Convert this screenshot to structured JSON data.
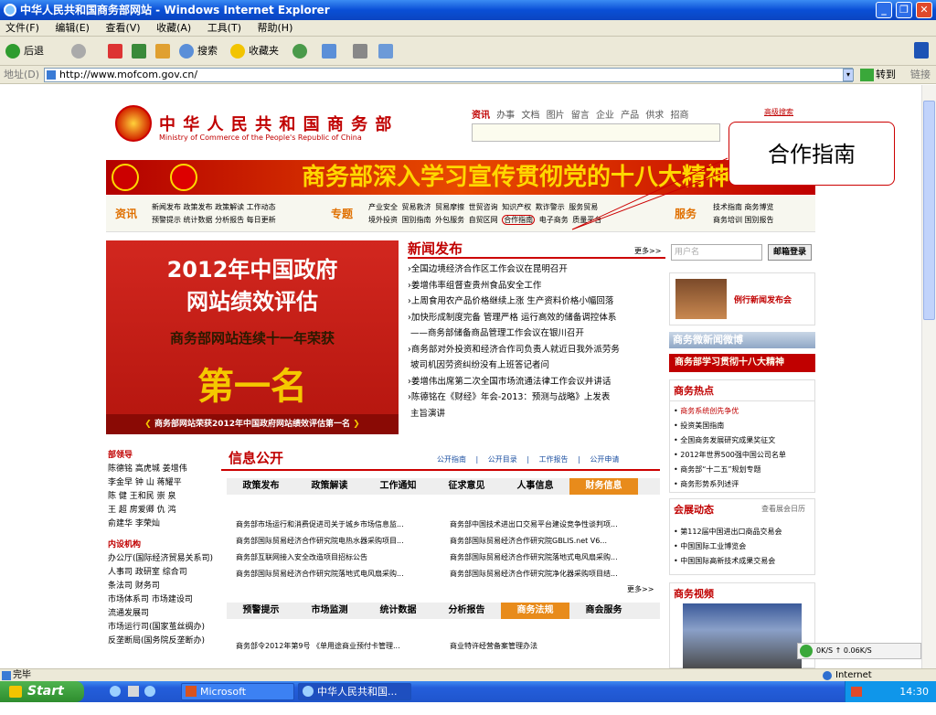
{
  "window": {
    "title": "中华人民共和国商务部网站 - Windows Internet Explorer",
    "min": "_",
    "max": "❐",
    "close": "✕"
  },
  "menu": [
    "文件(F)",
    "编辑(E)",
    "查看(V)",
    "收藏(A)",
    "工具(T)",
    "帮助(H)"
  ],
  "toolbar": {
    "back": "后退",
    "search": "搜索",
    "favorites": "收藏夹"
  },
  "address": {
    "label": "地址(D)",
    "url": "http://www.mofcom.gov.cn/",
    "go": "转到",
    "links": "链接"
  },
  "header": {
    "logo_cn": "中 华 人 民 共 和 国 商 务 部",
    "logo_en": "Ministry of Commerce of the People's Republic of China",
    "search_tabs": [
      "资讯",
      "办事",
      "文档",
      "图片",
      "留言",
      "企业",
      "产品",
      "供求",
      "招商"
    ],
    "advanced_search": "高级搜索"
  },
  "banner": {
    "text": "商务部深入学习宣传贯彻党的十八大精神"
  },
  "nav": {
    "g1_label": "资讯",
    "g1_row1": [
      "新闻发布",
      "政策发布",
      "政策解读",
      "工作动态"
    ],
    "g1_row2": [
      "预警提示",
      "统计数据",
      "分析报告",
      "每日更新"
    ],
    "g2_label": "专题",
    "g2_row1": [
      "产业安全",
      "贸易救济",
      "贸易摩擦",
      "世贸咨询",
      "知识产权",
      "欺诈警示",
      "服务贸易"
    ],
    "g2_row2": [
      "境外投资",
      "国别指南",
      "外包服务",
      "自贸区网",
      "合作指南",
      "电子商务",
      "质量平台"
    ],
    "g3_label": "服务",
    "g3_row1": [
      "技术指南",
      "商务博览"
    ],
    "g3_row2": [
      "商务培训",
      "国别报告"
    ]
  },
  "feature": {
    "line1": "2012年中国政府",
    "line2": "网站绩效评估",
    "line3": "商务部网站连续十一年荣获",
    "line4": "第一名",
    "caption": "商务部网站荣获2012年中国政府网站绩效评估第一名"
  },
  "news": {
    "title": "新闻发布",
    "more": "更多>>",
    "items": [
      "全国边境经济合作区工作会议在昆明召开",
      "姜增伟率组督查贵州食品安全工作",
      "上周食用农产品价格继续上涨 生产资料价格小幅回落",
      "加快形成制度完备 管理严格 运行高效的储备调控体系",
      "——商务部储备商品管理工作会议在银川召开",
      "商务部对外投资和经济合作司负责人就近日我外派劳务",
      "坡司机因劳资纠纷没有上班答记者问",
      "姜增伟出席第二次全国市场流通法律工作会议并讲话",
      "陈德铭在《财经》年会-2013：预测与战略》上发表",
      "主旨演讲"
    ]
  },
  "login": {
    "placeholder": "用户名",
    "button": "邮箱登录"
  },
  "right": {
    "press_conf": "例行新闻发布会",
    "weibo": "商务微新闻微博",
    "study": "商务部学习贯彻十八大精神",
    "hot_title": "商务热点",
    "hot_items": [
      "商务系统创先争优",
      "投资美国指南",
      "全国商务发展研究成果奖征文",
      "2012年世界500强中国公司名单",
      "商务部“十二五”规划专题",
      "商务形势系列述评"
    ],
    "expo_title": "会展动态",
    "expo_more": "查看展会日历",
    "expo_items": [
      "第112届中国进出口商品交易会",
      "中国国际工业博览会",
      "中国国际高新技术成果交易会"
    ],
    "video_title": "商务视频"
  },
  "leaders": {
    "title": "部领导",
    "rows": [
      "陈德铭  高虎城  姜增伟",
      "李金早  钟  山  蒋耀平",
      "陈  健  王和民  崇  泉",
      "王  超  房爱卿  仇  鸿",
      "俞建华  李荣灿"
    ]
  },
  "depts": {
    "title": "内设机构",
    "rows": [
      "办公厅(国际经济贸易关系司)",
      "人事司  政研室  综合司",
      "条法司  财务司",
      "市场体系司  市场建设司",
      "流通发展司",
      "市场运行司(国家茧丝绸办)",
      "反垄断局(国务院反垄断办)"
    ]
  },
  "info": {
    "title": "信息公开",
    "links": [
      "公开指南",
      "公开目录",
      "工作报告",
      "公开申请"
    ],
    "tabs1": [
      "政策发布",
      "政策解读",
      "工作通知",
      "征求意见",
      "人事信息",
      "财务信息"
    ],
    "items_left": [
      "商务部市场运行和消费促进司关于城乡市场信息监...",
      "商务部国际贸易经济合作研究院电热水器采购项目...",
      "商务部互联网接入安全改造项目招标公告",
      "商务部国际贸易经济合作研究院落地式电风扇采购..."
    ],
    "items_right": [
      "商务部中国技术进出口交易平台建设竞争性谈判项...",
      "商务部国际贸易经济合作研究院GBLIS.net V6...",
      "商务部国际贸易经济合作研究院落地式电风扇采购...",
      "商务部国际贸易经济合作研究院净化器采购项目结..."
    ],
    "more": "更多>>",
    "tabs2": [
      "预警提示",
      "市场监测",
      "统计数据",
      "分析报告",
      "商务法规",
      "商会服务"
    ],
    "law_left": "商务部令2012年第9号 《单用途商业预付卡管理...",
    "law_right": "商业特许经营备案管理办法"
  },
  "callout": "合作指南",
  "status": {
    "text": "完毕",
    "zone": "Internet",
    "speed": "0K/S  ↑ 0.06K/S"
  },
  "taskbar": {
    "start": "Start",
    "task1": "Microsoft PowerPo...",
    "task2": "中华人民共和国...",
    "clock": "14:30"
  },
  "colors": {
    "accent_red": "#c00000",
    "nav_blue": "#1d50a2",
    "tab_orange": "#e88b1b"
  }
}
